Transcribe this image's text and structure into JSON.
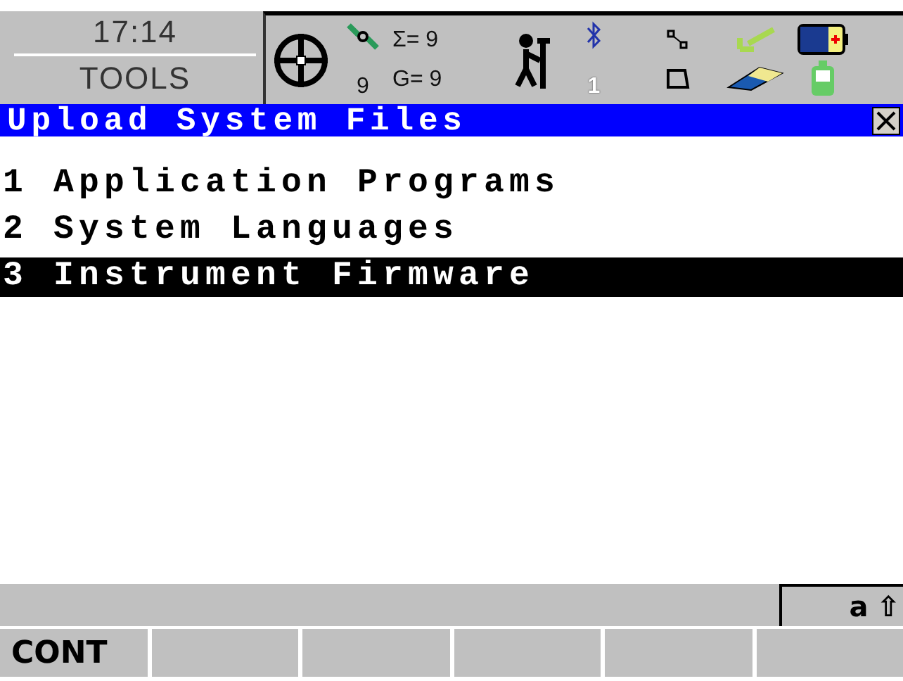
{
  "header": {
    "time": "17:14",
    "mode": "TOOLS",
    "sat_count": "9",
    "sigma": "Σ= 9",
    "gps": "G= 9",
    "bt_count": "1"
  },
  "window": {
    "title": "Upload System Files"
  },
  "menu": [
    {
      "number": "1",
      "label": "Application Programs",
      "selected": false
    },
    {
      "number": "2",
      "label": "System Languages",
      "selected": false
    },
    {
      "number": "3",
      "label": "Instrument Firmware",
      "selected": true
    }
  ],
  "status_bar": {
    "input_mode": "a",
    "shift": "⇧"
  },
  "softkeys": [
    {
      "kind": "labeled",
      "label": "CONT"
    },
    {
      "kind": "blank"
    },
    {
      "kind": "blank"
    },
    {
      "kind": "blank"
    },
    {
      "kind": "blank"
    },
    {
      "kind": "blank"
    }
  ]
}
